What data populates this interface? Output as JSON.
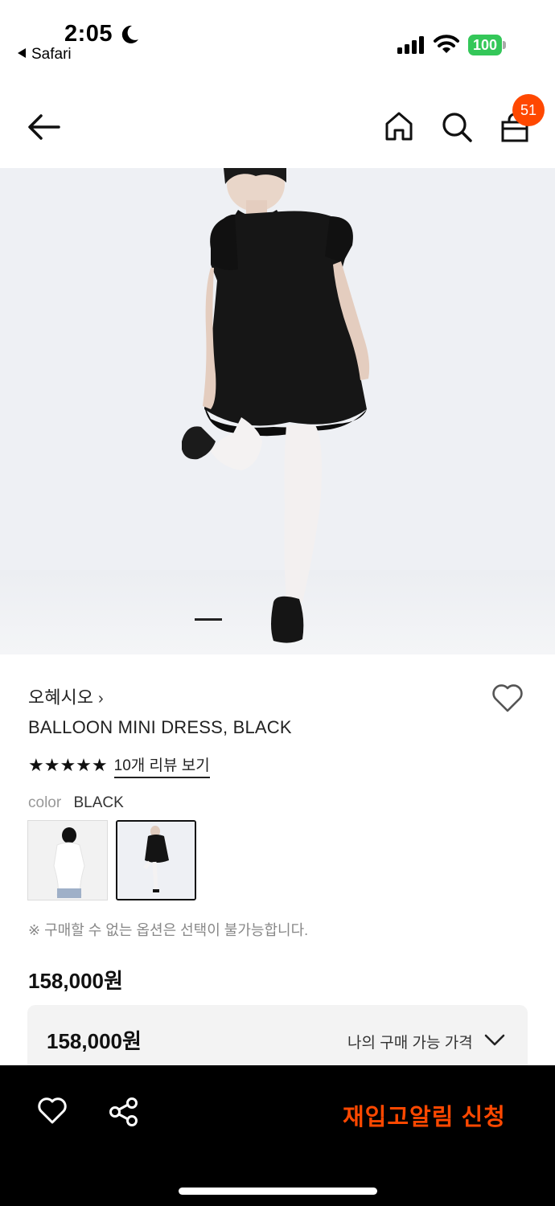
{
  "status_bar": {
    "time": "2:05",
    "back_app": "Safari",
    "battery": "100",
    "battery_color": "#34c759"
  },
  "nav": {
    "icons": [
      "back-arrow-icon",
      "home-icon",
      "search-icon",
      "shopping-bag-icon"
    ],
    "cart_count": "51",
    "badge_color": "#ff4800"
  },
  "product": {
    "image_page": 1,
    "brand": "오혜시오",
    "brand_chevron": "›",
    "name": "BALLOON MINI DRESS, BLACK",
    "rating": 5,
    "stars": "★★★★★",
    "review_link": "10개 리뷰 보기",
    "color_label": "color",
    "color_value": "BLACK",
    "swatches": [
      "white",
      "black"
    ],
    "selected_swatch": 1,
    "notice": "※ 구매할 수 없는 옵션은 선택이 불가능합니다.",
    "price": "158,000원"
  },
  "price_box": {
    "amount": "158,000원",
    "my_price_label": "나의 구매 가능 가격"
  },
  "bottom_bar": {
    "restock_label": "재입고알림 신청",
    "accent_color": "#ff4800"
  }
}
